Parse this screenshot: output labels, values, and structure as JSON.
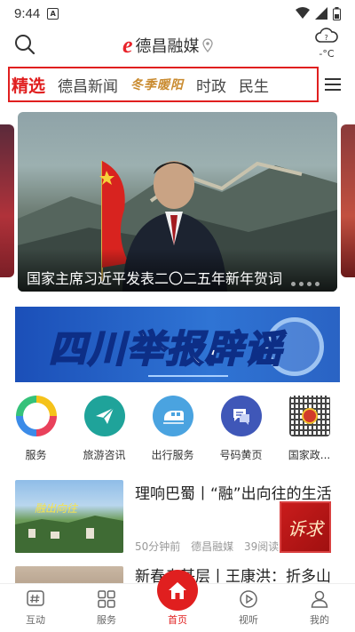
{
  "status_bar": {
    "time": "9:44",
    "notification_badge": "A"
  },
  "header": {
    "logo_mark": "e",
    "logo_text": "德昌融媒",
    "weather_temp": "-°C",
    "weather_unknown": "?"
  },
  "tabs": [
    {
      "label": "精选",
      "active": true
    },
    {
      "label": "德昌新闻"
    },
    {
      "label": "冬季暖阳",
      "style": "artistic"
    },
    {
      "label": "时政"
    },
    {
      "label": "民生"
    }
  ],
  "carousel": {
    "caption": "国家主席习近平发表二〇二五年新年贺词"
  },
  "banner": {
    "text": "四川举报辟谣"
  },
  "services": [
    {
      "label": "服务",
      "icon": "ring-icon",
      "color": "#f0a020"
    },
    {
      "label": "旅游咨讯",
      "icon": "paper-plane-icon",
      "color": "#1fa39a"
    },
    {
      "label": "出行服务",
      "icon": "train-icon",
      "color": "#4aa3e0"
    },
    {
      "label": "号码黄页",
      "icon": "chat-bubble-icon",
      "color": "#3f57b8"
    },
    {
      "label": "国家政...",
      "icon": "national-emblem-qr-icon",
      "color": "#d23a2a"
    }
  ],
  "news": [
    {
      "title": "理响巴蜀丨“融”出向往的生活",
      "time": "50分钟前",
      "source": "德昌融媒",
      "reads": "39阅读"
    },
    {
      "title": "新春走基层丨王康洪：折多山"
    }
  ],
  "float_badge": {
    "text": "诉求"
  },
  "bottom_nav": [
    {
      "label": "互动",
      "icon": "hash-icon"
    },
    {
      "label": "服务",
      "icon": "grid-icon"
    },
    {
      "label": "首页",
      "icon": "home-icon",
      "active": true
    },
    {
      "label": "视听",
      "icon": "play-icon"
    },
    {
      "label": "我的",
      "icon": "user-icon"
    }
  ]
}
